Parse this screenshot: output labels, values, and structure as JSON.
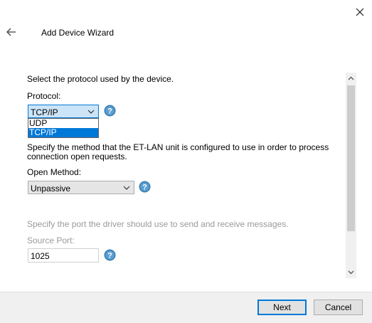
{
  "window": {
    "title": "Add Device Wizard"
  },
  "protocol": {
    "instruction": "Select the protocol used by the device.",
    "label": "Protocol:",
    "selected": "TCP/IP",
    "options": [
      "UDP",
      "TCP/IP"
    ],
    "dropdown_open": true
  },
  "open_method": {
    "instruction": "Specify the method that the ET-LAN unit is configured to use in order to process connection open requests.",
    "label": "Open Method:",
    "selected": "Unpassive"
  },
  "source_port": {
    "instruction": "Specify the port the driver should use to send and receive messages.",
    "label": "Source Port:",
    "value": "1025"
  },
  "footer": {
    "next_label": "Next",
    "cancel_label": "Cancel"
  },
  "icons": [
    "close-icon",
    "back-arrow-icon",
    "chevron-down-icon",
    "help-icon",
    "scroll-up-icon",
    "scroll-down-icon"
  ],
  "colors": {
    "accent": "#0078d7",
    "help_icon": "#3c7fb1",
    "footer_bg": "#f0f0f0",
    "muted_text": "#9a9a9a"
  }
}
